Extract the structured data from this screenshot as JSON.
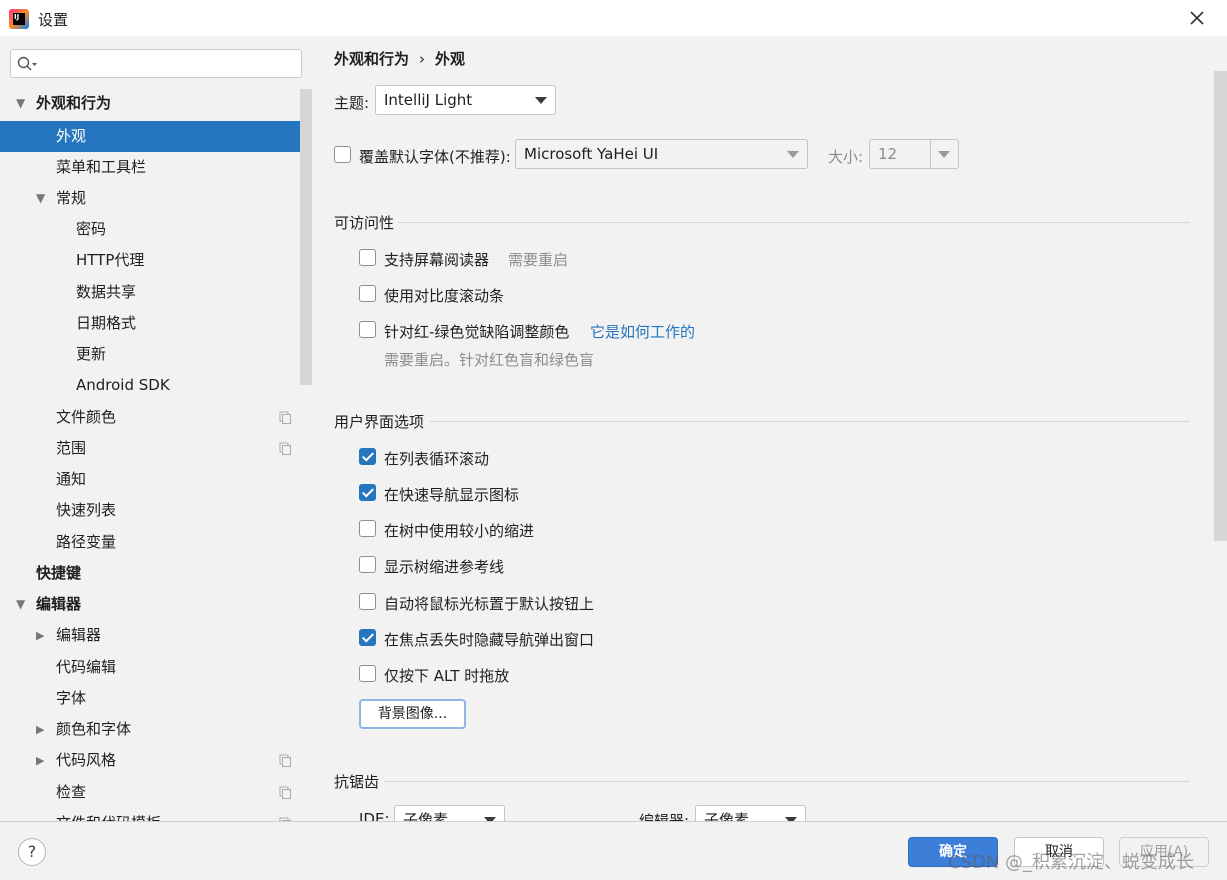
{
  "window": {
    "title": "设置",
    "app_logo_text": "IJ"
  },
  "search": {
    "placeholder": ""
  },
  "sidebar": {
    "items": [
      {
        "label": "外观和行为",
        "arrow": "▼"
      },
      {
        "label": "外观"
      },
      {
        "label": "菜单和工具栏"
      },
      {
        "label": "常规",
        "arrow": "▼"
      },
      {
        "label": "密码"
      },
      {
        "label": "HTTP代理"
      },
      {
        "label": "数据共享"
      },
      {
        "label": "日期格式"
      },
      {
        "label": "更新"
      },
      {
        "label": "Android SDK"
      },
      {
        "label": "文件颜色"
      },
      {
        "label": "范围"
      },
      {
        "label": "通知"
      },
      {
        "label": "快速列表"
      },
      {
        "label": "路径变量"
      },
      {
        "label": "快捷键"
      },
      {
        "label": "编辑器",
        "arrow": "▼"
      },
      {
        "label": "编辑器",
        "arrow": "▶"
      },
      {
        "label": "代码编辑"
      },
      {
        "label": "字体"
      },
      {
        "label": "颜色和字体",
        "arrow": "▶"
      },
      {
        "label": "代码风格",
        "arrow": "▶"
      },
      {
        "label": "检查"
      },
      {
        "label": "文件和代码模板"
      }
    ]
  },
  "breadcrumb": {
    "parent": "外观和行为",
    "separator": "›",
    "current": "外观"
  },
  "theme": {
    "label": "主题:",
    "value": "IntelliJ Light"
  },
  "font_override": {
    "label": "覆盖默认字体(不推荐):",
    "font": "Microsoft YaHei UI",
    "size_label": "大小:",
    "size": "12",
    "checked": false
  },
  "accessibility": {
    "title": "可访问性",
    "screen_reader": {
      "label": "支持屏幕阅读器",
      "note": "需要重启",
      "checked": false
    },
    "contrast_scrollbars": {
      "label": "使用对比度滚动条",
      "checked": false
    },
    "color_blind": {
      "label": "针对红-绿色觉缺陷调整颜色",
      "link": "它是如何工作的",
      "note": "需要重启。针对红色盲和绿色盲",
      "checked": false
    }
  },
  "ui_options": {
    "title": "用户界面选项",
    "options": [
      {
        "label": "在列表循环滚动",
        "checked": true
      },
      {
        "label": "在快速导航显示图标",
        "checked": true
      },
      {
        "label": "在树中使用较小的缩进",
        "checked": false
      },
      {
        "label": "显示树缩进参考线",
        "checked": false
      },
      {
        "label": "自动将鼠标光标置于默认按钮上",
        "checked": false
      },
      {
        "label": "在焦点丢失时隐藏导航弹出窗口",
        "checked": true
      },
      {
        "label": "仅按下 ALT 时拖放",
        "checked": false
      }
    ],
    "background_button": "背景图像..."
  },
  "antialiasing": {
    "title": "抗锯齿",
    "ide_label": "IDE:",
    "ide_value": "子像素",
    "editor_label": "编辑器:",
    "editor_value": "子像素"
  },
  "footer": {
    "help": "?",
    "ok": "确定",
    "cancel": "取消",
    "apply": "应用(A)",
    "watermark": "CSDN @_积累沉淀、蜕变成长"
  }
}
